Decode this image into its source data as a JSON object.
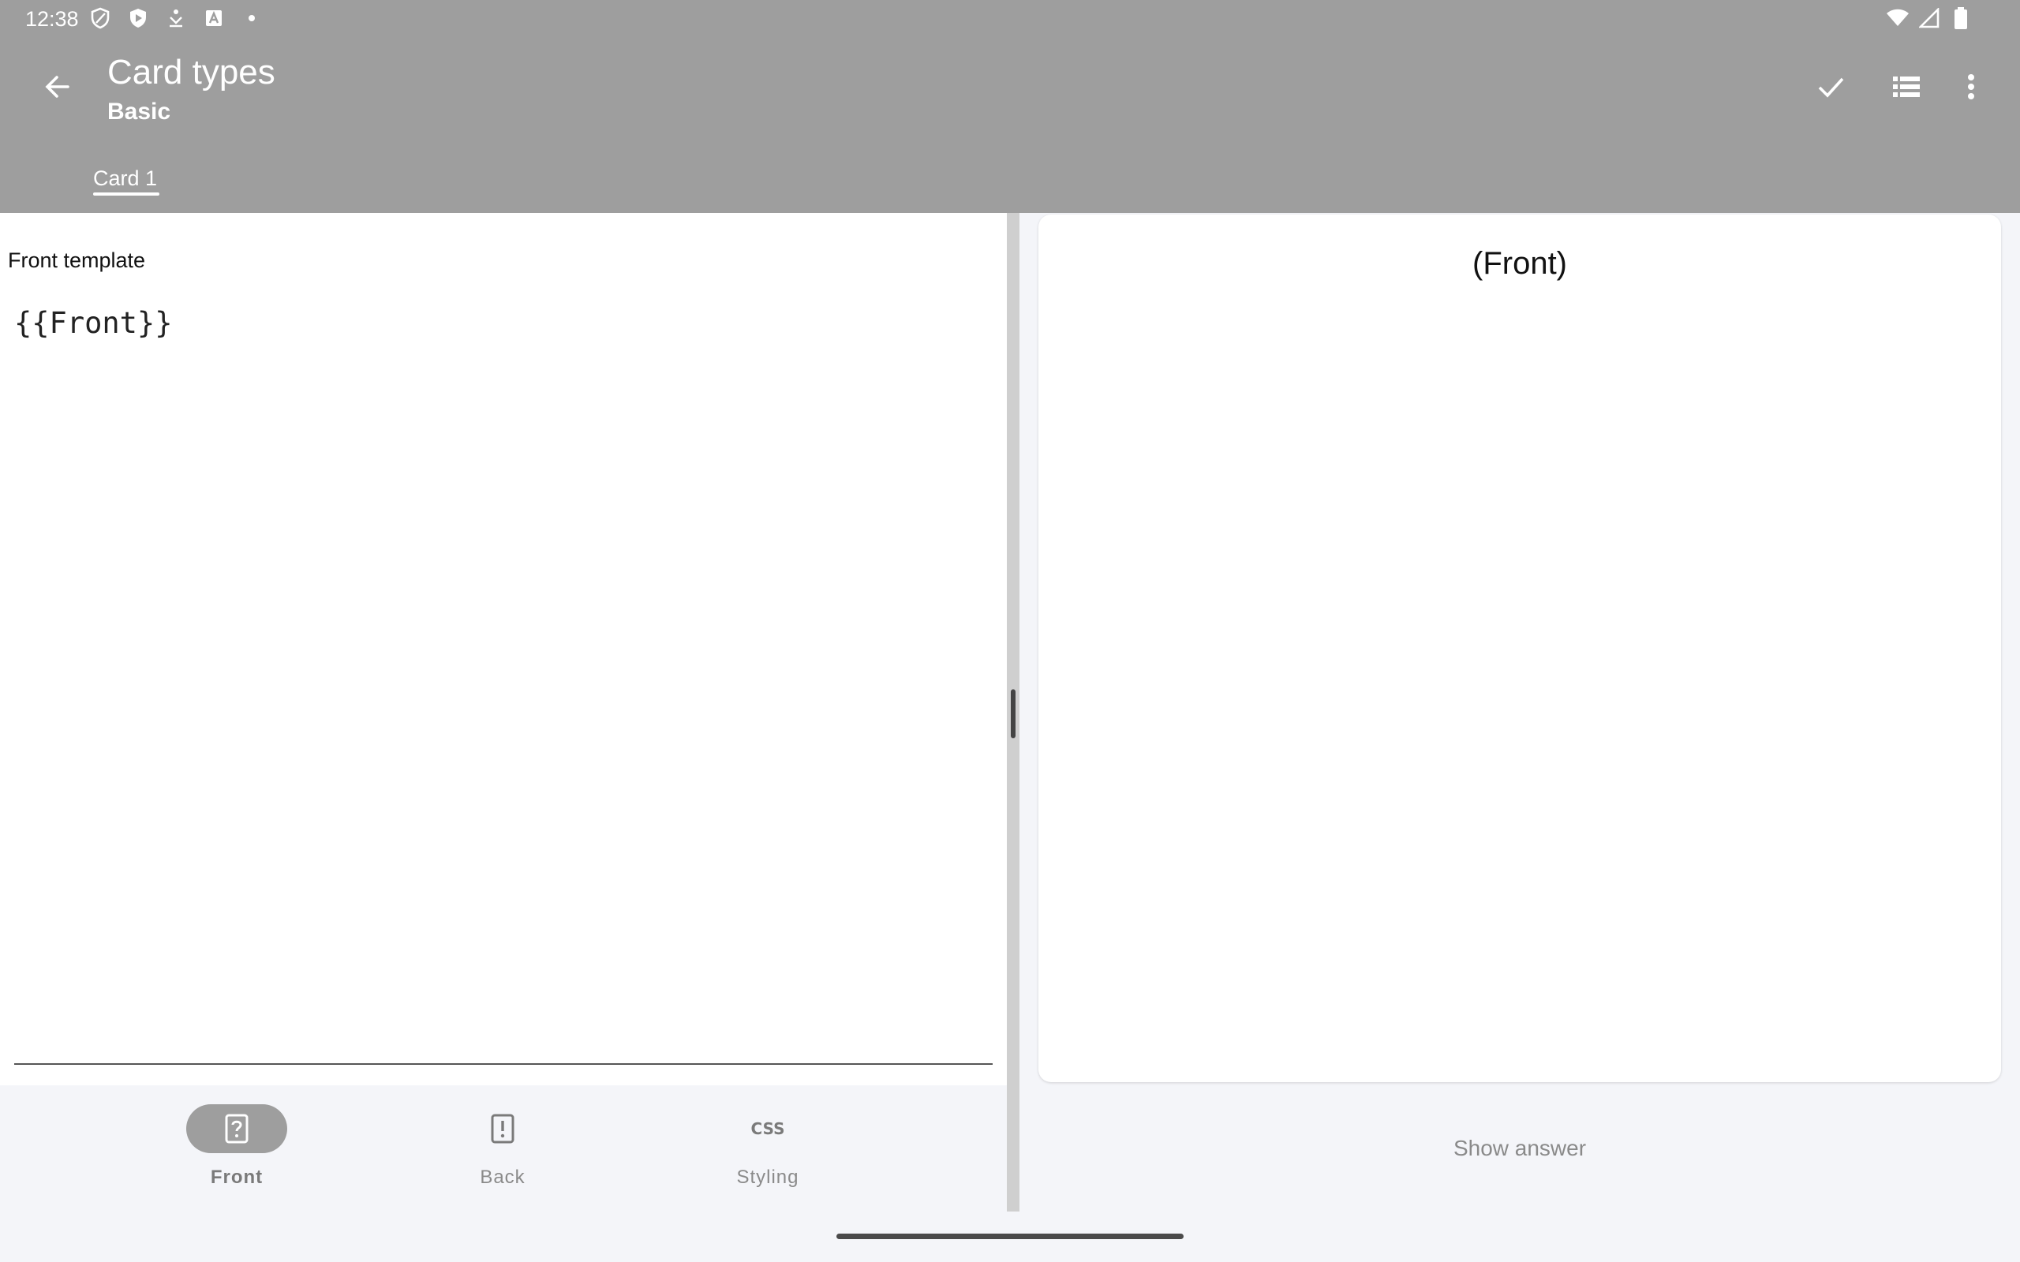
{
  "status_bar": {
    "time": "12:38",
    "left_icons": [
      "shield-outline-icon",
      "shield-play-icon",
      "download-icon",
      "a-box-icon",
      "dot-icon"
    ],
    "right_icons": [
      "wifi-icon",
      "signal-icon",
      "battery-icon"
    ]
  },
  "appbar": {
    "title": "Card types",
    "subtitle": "Basic",
    "actions": [
      "check-icon",
      "list-icon",
      "more-vert-icon"
    ],
    "tabs": [
      {
        "label": "Card 1",
        "selected": true
      }
    ]
  },
  "editor": {
    "label": "Front template",
    "content": "{{Front}}"
  },
  "bottom_nav": {
    "items": [
      {
        "label": "Front",
        "icon": "card-question-icon",
        "selected": true
      },
      {
        "label": "Back",
        "icon": "card-exclamation-icon",
        "selected": false
      },
      {
        "label": "Styling",
        "icon": "css-icon",
        "icon_text": "CSS",
        "selected": false
      }
    ]
  },
  "preview": {
    "content": "(Front)",
    "show_answer_label": "Show answer"
  },
  "colors": {
    "appbar": "#9e9e9e",
    "background": "#f4f5f9",
    "pane": "#ffffff",
    "muted_text": "#8a8a8a"
  }
}
